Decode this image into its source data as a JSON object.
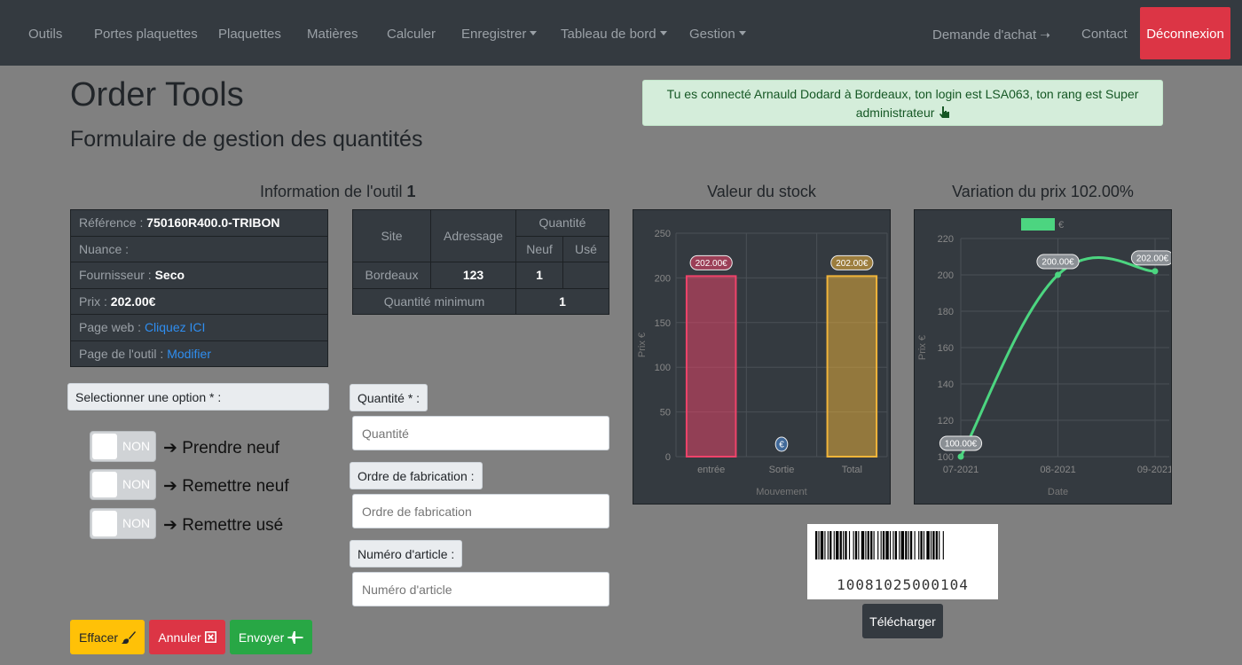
{
  "nav": {
    "items": [
      {
        "label": "Outils"
      },
      {
        "label": "Portes plaquettes"
      },
      {
        "label": "Plaquettes"
      },
      {
        "label": "Matières"
      },
      {
        "label": "Calculer"
      },
      {
        "label": "Enregistrer"
      },
      {
        "label": "Tableau de bord"
      },
      {
        "label": "Gestion"
      }
    ],
    "purchase": "Demande d'achat",
    "purchase_icon": "arrow-right-icon",
    "contact": "Contact",
    "logout": "Déconnexion"
  },
  "header": {
    "title": "Order Tools",
    "subtitle": "Formulaire de gestion des quantités",
    "alert_text": "Tu es connecté Arnauld Dodard à Bordeaux, ton login est LSA063, ton rang est Super administrateur",
    "alert_icon": "pointing-hand-icon"
  },
  "info": {
    "title": "Information de l'outil",
    "tool_number": "1",
    "reference_label": "Référence : ",
    "reference_value": "750160R400.0-TRIBON",
    "nuance_label": "Nuance :",
    "supplier_label": "Fournisseur : ",
    "supplier_value": "Seco",
    "price_label": "Prix : ",
    "price_value": "202.00€",
    "web_label": "Page web : ",
    "web_link": "Cliquez ICI",
    "tool_page_label": "Page de l'outil : ",
    "tool_page_link": "Modifier"
  },
  "qty_table": {
    "site_header": "Site",
    "address_header": "Adressage",
    "quantity_header": "Quantité",
    "new_header": "Neuf",
    "used_header": "Usé",
    "site": "Bordeaux",
    "address": "123",
    "new": "1",
    "used": "",
    "min_label": "Quantité minimum",
    "min_value": "1"
  },
  "form": {
    "select_label": "Selectionner une option * :",
    "options": [
      {
        "state": "NON",
        "label": "Prendre neuf"
      },
      {
        "state": "NON",
        "label": "Remettre neuf"
      },
      {
        "state": "NON",
        "label": "Remettre usé"
      }
    ],
    "quantity_label": "Quantité * :",
    "quantity_placeholder": "Quantité",
    "order_label": "Ordre de fabrication :",
    "order_placeholder": "Ordre de fabrication",
    "article_label": "Numéro d'article :",
    "article_placeholder": "Numéro d'article"
  },
  "buttons": {
    "clear": "Effacer",
    "cancel": "Annuler",
    "send": "Envoyer"
  },
  "chart_data": [
    {
      "type": "bar",
      "title": "Valeur du stock",
      "categories": [
        "entrée",
        "Sortie",
        "Total"
      ],
      "values": [
        202,
        0,
        202
      ],
      "data_labels": [
        "202.00€",
        "€",
        "202.00€"
      ],
      "xlabel": "Mouvement",
      "ylabel": "Prix €",
      "ylim": [
        0,
        250
      ],
      "yticks": [
        0,
        50,
        100,
        150,
        200,
        250
      ],
      "colors": [
        "#f0436a",
        "#4a90e2",
        "#f2b53a"
      ],
      "grid": true
    },
    {
      "type": "line",
      "title": "Variation du prix 102.00%",
      "categories": [
        "07-2021",
        "08-2021",
        "09-2021"
      ],
      "series": [
        {
          "name": "€",
          "values": [
            100,
            200,
            202
          ]
        }
      ],
      "data_labels": [
        "100.00€",
        "200.00€",
        "202.00€"
      ],
      "xlabel": "Date",
      "ylabel": "Prix €",
      "ylim": [
        100,
        220
      ],
      "yticks": [
        100,
        120,
        140,
        160,
        180,
        200,
        220
      ],
      "legend": "top",
      "color": "#4cd580",
      "grid": true
    }
  ],
  "barcode": {
    "number": "10081025000104",
    "download": "Télécharger"
  }
}
